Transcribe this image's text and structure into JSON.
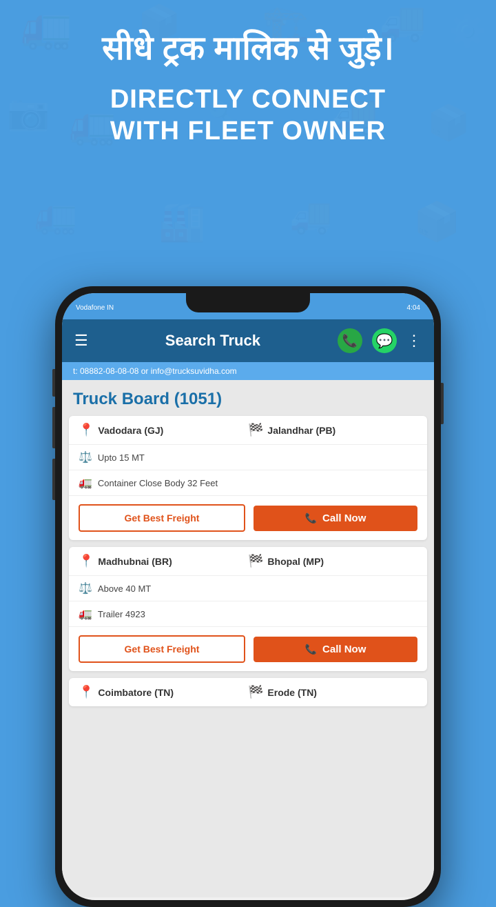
{
  "hero": {
    "hindi_title": "सीधे ट्रक मालिक से जुड़े।",
    "english_line1": "DIRECTLY CONNECT",
    "english_line2": "WITH FLEET OWNER"
  },
  "phone": {
    "status": {
      "carrier": "Vodafone IN",
      "time": "4:04"
    },
    "appbar": {
      "title": "Search Truck"
    },
    "info_banner": "t: 08882-08-08-08 or info@trucksuvidha.com",
    "board_title": "Truck Board (1051)",
    "cards": [
      {
        "from": "Vadodara (GJ)",
        "to": "Jalandhar (PB)",
        "weight": "Upto 15 MT",
        "vehicle": "Container Close Body  32 Feet",
        "btn_freight": "Get Best Freight",
        "btn_call": "Call Now"
      },
      {
        "from": "Madhubnai (BR)",
        "to": "Bhopal (MP)",
        "weight": "Above 40 MT",
        "vehicle": "Trailer 4923",
        "btn_freight": "Get Best Freight",
        "btn_call": "Call Now"
      },
      {
        "from": "Coimbatore (TN)",
        "to": "Erode (TN)",
        "weight": "",
        "vehicle": "",
        "btn_freight": "",
        "btn_call": ""
      }
    ]
  }
}
